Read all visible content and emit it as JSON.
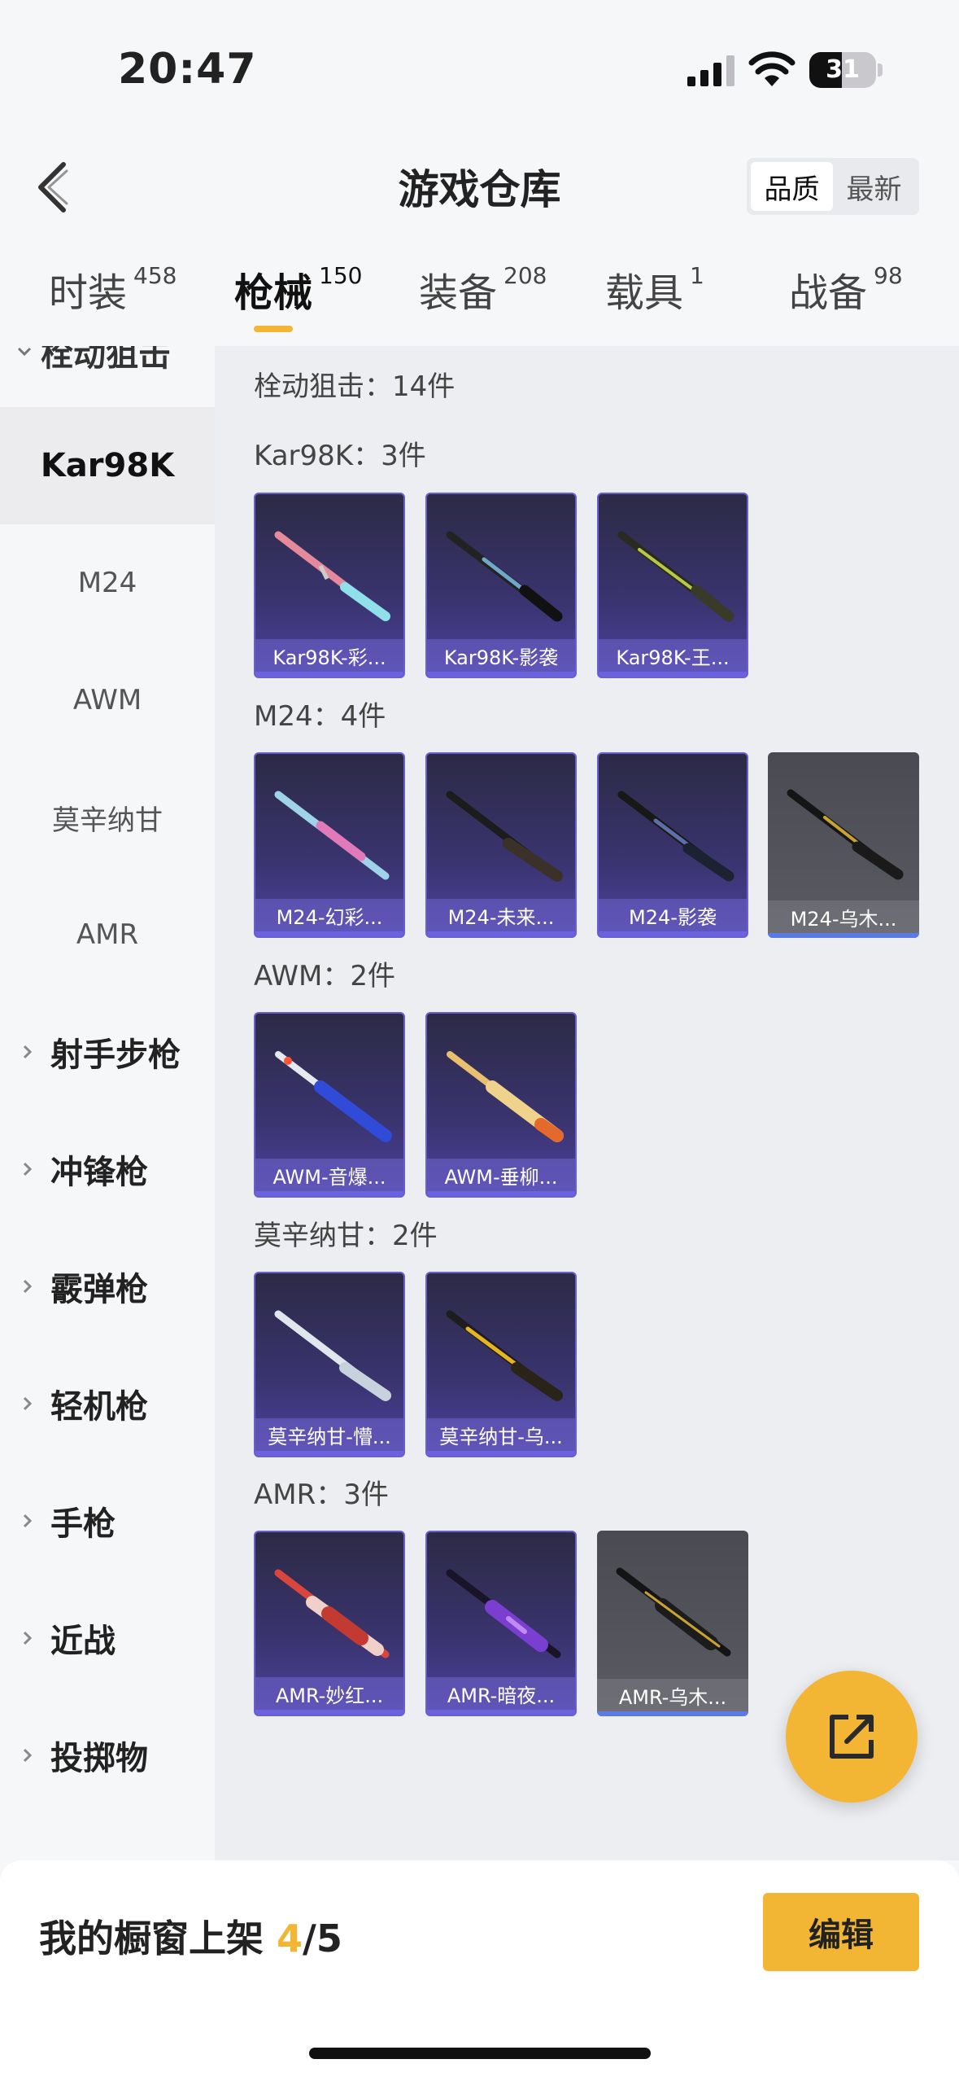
{
  "status": {
    "time": "20:47",
    "battery": "31"
  },
  "header": {
    "title": "游戏仓库",
    "sort": [
      "品质",
      "最新"
    ]
  },
  "tabs": [
    {
      "label": "时装",
      "count": "458"
    },
    {
      "label": "枪械",
      "count": "150"
    },
    {
      "label": "装备",
      "count": "208"
    },
    {
      "label": "载具",
      "count": "1"
    },
    {
      "label": "战备",
      "count": "98"
    }
  ],
  "sidebar": {
    "clipped": "栓动狙击",
    "subs": [
      "Kar98K",
      "M24",
      "AWM",
      "莫辛纳甘",
      "AMR"
    ],
    "cats": [
      "射手步枪",
      "冲锋枪",
      "霰弹枪",
      "轻机枪",
      "手枪",
      "近战",
      "投掷物"
    ]
  },
  "main": {
    "summary": "栓动狙击：14件",
    "sections": [
      {
        "heading": "Kar98K：3件",
        "items": [
          "Kar98K-彩...",
          "Kar98K-影袭",
          "Kar98K-王..."
        ]
      },
      {
        "heading": "M24：4件",
        "items": [
          "M24-幻彩...",
          "M24-未来...",
          "M24-影袭",
          "M24-乌木..."
        ]
      },
      {
        "heading": "AWM：2件",
        "items": [
          "AWM-音爆...",
          "AWM-垂柳..."
        ]
      },
      {
        "heading": "莫辛纳甘：2件",
        "items": [
          "莫辛纳甘-懵...",
          "莫辛纳甘-乌..."
        ]
      },
      {
        "heading": "AMR：3件",
        "items": [
          "AMR-妙红...",
          "AMR-暗夜...",
          "AMR-乌木..."
        ]
      }
    ]
  },
  "bottom": {
    "label": "我的橱窗上架",
    "current": "4",
    "total": "/5",
    "edit": "编辑"
  },
  "colors": {
    "accent": "#f2b534",
    "card_purple": "#3a3470",
    "card_gray": "#55565d"
  }
}
